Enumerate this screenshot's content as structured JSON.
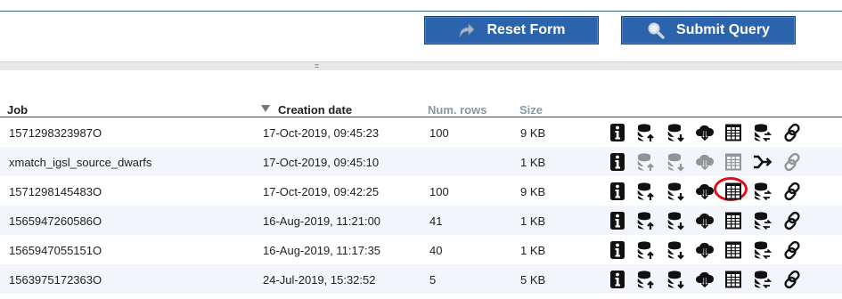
{
  "toolbar": {
    "reset_label": "Reset Form",
    "submit_label": "Submit Query"
  },
  "splitter": {
    "grip": "="
  },
  "jobs_table": {
    "columns": {
      "job": "Job",
      "creation_date": "Creation date",
      "num_rows": "Num. rows",
      "size": "Size"
    },
    "sort": {
      "column": "creation_date",
      "direction": "descending"
    },
    "rows": [
      {
        "job": "1571298323987O",
        "date": "17-Oct-2019, 09:45:23",
        "rows": "100",
        "size": "9 KB",
        "kind": "normal"
      },
      {
        "job": "xmatch_igsl_source_dwarfs",
        "date": "17-Oct-2019, 09:45:10",
        "rows": "",
        "size": "1 KB",
        "kind": "xmatch"
      },
      {
        "job": "1571298145483O",
        "date": "17-Oct-2019, 09:42:25",
        "rows": "100",
        "size": "9 KB",
        "kind": "normal",
        "highlighted_action": "view-table"
      },
      {
        "job": "1565947260586O",
        "date": "16-Aug-2019, 11:21:00",
        "rows": "41",
        "size": "1 KB",
        "kind": "normal"
      },
      {
        "job": "1565947055151O",
        "date": "16-Aug-2019, 11:17:35",
        "rows": "40",
        "size": "1 KB",
        "kind": "normal"
      },
      {
        "job": "1563975172363O",
        "date": "24-Jul-2019, 15:32:52",
        "rows": "5",
        "size": "5 KB",
        "kind": "normal"
      }
    ],
    "actions": [
      "info-icon",
      "upload-to-database-icon",
      "download-from-database-icon",
      "cloud-download-icon",
      "view-table-icon",
      "database-share-icon",
      "link-icon"
    ],
    "xmatch_actions": [
      "info-icon",
      "upload-to-database-icon",
      "download-from-database-icon",
      "cloud-download-icon",
      "view-table-icon",
      "crossmatch-merge-icon",
      "link-icon"
    ],
    "highlight_color": "#e0101b"
  },
  "colors": {
    "button_bg": "#2b63ad",
    "header_rule": "#4a4a4a",
    "row_alt": "#f2f5f9"
  }
}
